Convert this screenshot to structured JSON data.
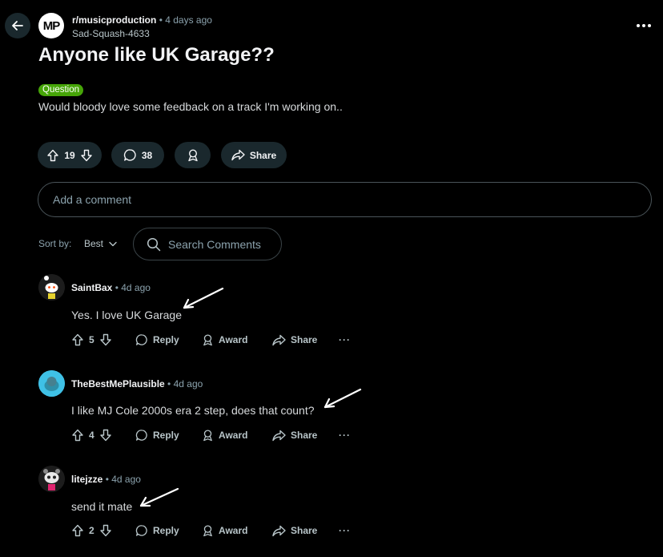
{
  "header": {
    "subreddit": "r/musicproduction",
    "post_age": "4 days ago",
    "author": "Sad-Squash-4633",
    "sub_avatar_text": "MP"
  },
  "post": {
    "title": "Anyone like UK Garage??",
    "flair": "Question",
    "flair_color": "#46a508",
    "body": "Would bloody love some feedback on a track I'm working on..",
    "votes": "19",
    "comments_count": "38",
    "share_label": "Share"
  },
  "comment_box": {
    "placeholder": "Add a comment"
  },
  "sort": {
    "label": "Sort by:",
    "value": "Best"
  },
  "search": {
    "placeholder": "Search Comments"
  },
  "comments": [
    {
      "user": "SaintBax",
      "age": "4d ago",
      "text": "Yes. I love UK Garage",
      "votes": "5",
      "reply": "Reply",
      "award": "Award",
      "share": "Share",
      "more": "···"
    },
    {
      "user": "TheBestMePlausible",
      "age": "4d ago",
      "text": "I like MJ Cole 2000s era 2 step, does that count?",
      "votes": "4",
      "reply": "Reply",
      "award": "Award",
      "share": "Share",
      "more": "···"
    },
    {
      "user": "litejzze",
      "age": "4d ago",
      "text": "send it mate",
      "votes": "2",
      "reply": "Reply",
      "award": "Award",
      "share": "Share",
      "more": "···"
    }
  ],
  "icons": {
    "back": "arrow-left-icon",
    "more": "ellipsis-icon",
    "upvote": "upvote-icon",
    "downvote": "downvote-icon",
    "comment": "comment-bubble-icon",
    "award": "award-icon",
    "share": "share-arrow-icon",
    "search": "search-icon",
    "chevron": "chevron-down-icon"
  },
  "colors": {
    "background": "#000000",
    "pill_bg": "#1a282d",
    "muted_text": "#8ba2ad"
  }
}
